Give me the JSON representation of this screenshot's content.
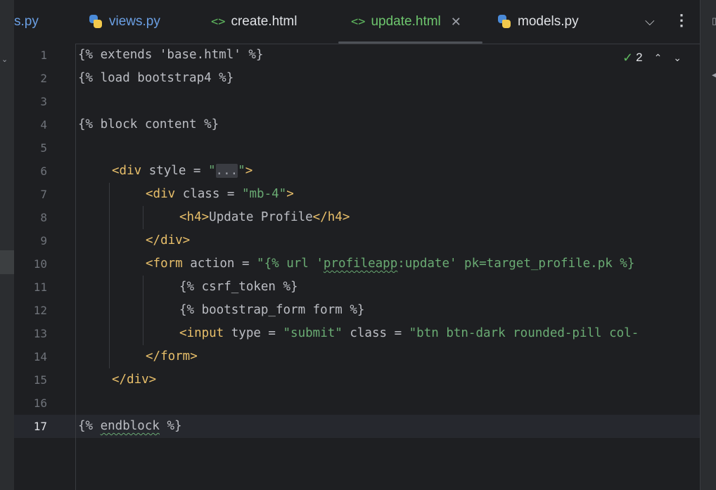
{
  "tabs": [
    {
      "label": "s.py",
      "icon": "python-icon",
      "active": false
    },
    {
      "label": "views.py",
      "icon": "python-icon",
      "active": false
    },
    {
      "label": "create.html",
      "icon": "html-icon",
      "active": false
    },
    {
      "label": "update.html",
      "icon": "html-icon",
      "active": true
    },
    {
      "label": "models.py",
      "icon": "python-icon",
      "active": false
    }
  ],
  "tab_controls": {
    "chevron": "⌵",
    "more": "⋮",
    "close": "✕"
  },
  "inspection": {
    "count": "2",
    "check_icon": "double-check-icon",
    "up": "⌃",
    "down": "⌄"
  },
  "line_numbers": [
    "1",
    "2",
    "3",
    "4",
    "5",
    "6",
    "7",
    "8",
    "9",
    "10",
    "11",
    "12",
    "13",
    "14",
    "15",
    "16",
    "17"
  ],
  "current_line": 17,
  "code": {
    "l1": "{% extends 'base.html' %}",
    "l2": "{% load bootstrap4 %}",
    "l4": "{% block content %}",
    "l6": {
      "open": "<div",
      "attr": " style = ",
      "q1": "\"",
      "fold": "...",
      "q2": "\"",
      "close": ">"
    },
    "l7": {
      "open": "<div",
      "attr": " class = ",
      "val": "\"mb-4\"",
      "close": ">"
    },
    "l8": {
      "open": "<h4>",
      "text": "Update Profile",
      "close": "</h4>"
    },
    "l9": "</div>",
    "l10": {
      "open": "<form",
      "attr": " action = ",
      "val_a": "\"{% url '",
      "val_u": "profileapp",
      "val_b": ":update' pk=target_profile.pk %}"
    },
    "l11": "{% csrf_token %}",
    "l12": "{% bootstrap_form form %}",
    "l13": {
      "open": "<input",
      "attr1": " type = ",
      "val1": "\"submit\"",
      "attr2": " class = ",
      "val2": "\"btn btn-dark rounded-pill col-"
    },
    "l14": "</form>",
    "l15": "</div>",
    "l17_a": "{% ",
    "l17_b": "endblock",
    "l17_c": " %}"
  }
}
